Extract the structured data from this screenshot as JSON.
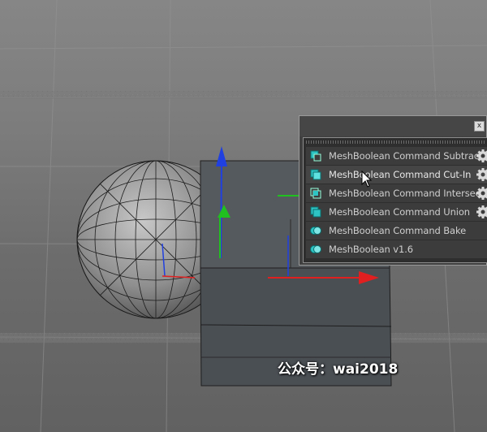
{
  "popup": {
    "close_label": "x",
    "items": [
      {
        "label": "MeshBoolean Command Subtract",
        "icon": "subtract-icon",
        "has_settings": true
      },
      {
        "label": "MeshBoolean Command Cut-In",
        "icon": "cut-in-icon",
        "has_settings": true
      },
      {
        "label": "MeshBoolean Command Intersect",
        "icon": "intersect-icon",
        "has_settings": true
      },
      {
        "label": "MeshBoolean Command Union",
        "icon": "union-icon",
        "has_settings": true
      },
      {
        "label": "MeshBoolean Command Bake",
        "icon": "bake-icon",
        "has_settings": false
      },
      {
        "label": "MeshBoolean v1.6",
        "icon": "version-icon",
        "has_settings": false
      }
    ],
    "hovered_index": 1
  },
  "watermark": "公众号：wai2018",
  "colors": {
    "accent_cyan": "#2ec4c4",
    "axis_x": "#e02020",
    "axis_y": "#20c020",
    "axis_z": "#2040e0",
    "panel_bg": "#3c3c3c"
  }
}
